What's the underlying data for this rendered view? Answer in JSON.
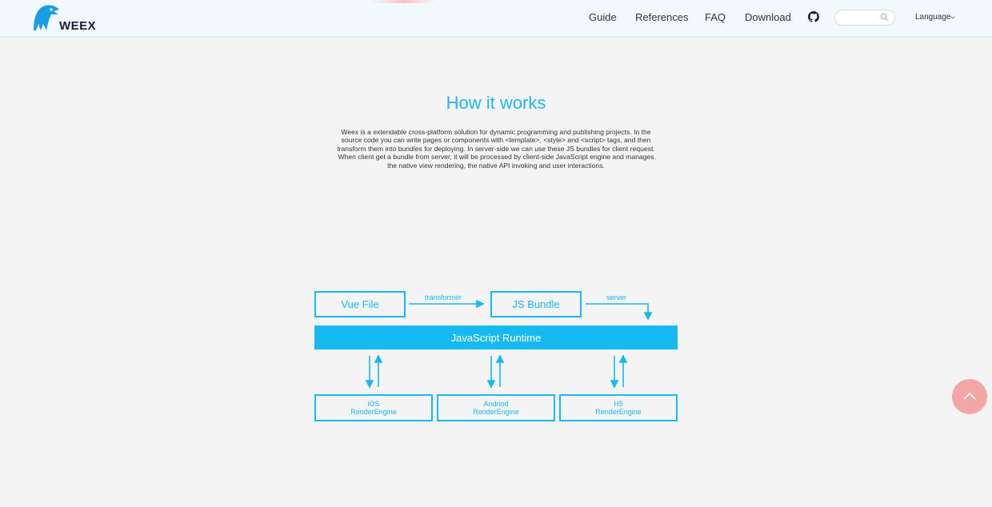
{
  "header": {
    "logo_text": "WEEX",
    "nav": [
      "Guide",
      "References",
      "FAQ",
      "Download"
    ],
    "search_placeholder": "",
    "language_label": "Language"
  },
  "main": {
    "title": "How it works",
    "description": "Weex is a extendable cross-platform solution for dynamic programming and publishing projects. In the source code you can write pages or components with <template>, <style> and <script> tags, and then transform them into bundles for deploying. In server-side we can use these JS bundles for client request. When client get a bundle from server, it will be processed by client-side JavaScript engine and manages the native view rendering, the native API invoking and user interactions."
  },
  "diagram": {
    "vue_file": "Vue File",
    "transformer": "transformer",
    "js_bundle": "JS Bundle",
    "server": "server",
    "runtime": "JavaScript Runtime",
    "engines": [
      {
        "line1": "iOS",
        "line2": "RenderEngine"
      },
      {
        "line1": "Andriod",
        "line2": "RenderEngine"
      },
      {
        "line1": "H5",
        "line2": "RenderEngine"
      }
    ]
  },
  "colors": {
    "accent": "#16b9f0",
    "header_bg": "#f1f9fc",
    "page_bg": "#f4f4f4",
    "back_to_top": "#f2a6a6"
  },
  "icons": [
    "weex-logo-icon",
    "github-icon",
    "search-icon",
    "chevron-down-icon",
    "chevron-up-icon"
  ]
}
